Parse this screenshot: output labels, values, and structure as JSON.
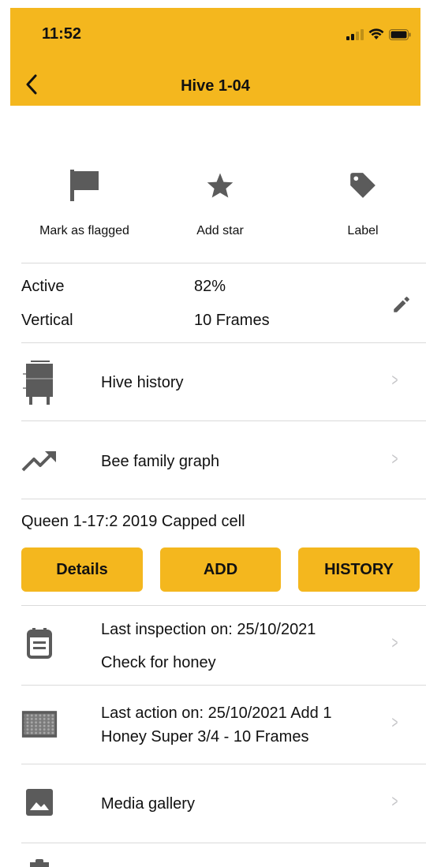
{
  "status_bar": {
    "time": "11:52"
  },
  "header": {
    "title": "Hive 1-04"
  },
  "quick_actions": [
    {
      "label": "Mark as flagged",
      "icon": "flag-icon"
    },
    {
      "label": "Add star",
      "icon": "star-icon"
    },
    {
      "label": "Label",
      "icon": "tag-icon"
    }
  ],
  "hive_info": {
    "status": "Active",
    "strength": "82%",
    "type": "Vertical",
    "frames": "10 Frames"
  },
  "menu": {
    "hive_history": "Hive history",
    "bee_family_graph": "Bee family graph"
  },
  "queen": {
    "text": "Queen 1-17:2 2019 Capped cell",
    "details_label": "Details",
    "add_label": "ADD",
    "history_label": "HISTORY"
  },
  "inspection": {
    "line1": "Last inspection on: 25/10/2021",
    "line2": "Check for honey"
  },
  "action": {
    "line1": "Last action on: 25/10/2021 Add 1",
    "line2": "Honey Super 3/4 - 10 Frames"
  },
  "media": {
    "label": "Media gallery"
  },
  "colors": {
    "accent": "#F4B71E",
    "icon_gray": "#5b5b5b",
    "chevron": "#c4c4c7"
  }
}
